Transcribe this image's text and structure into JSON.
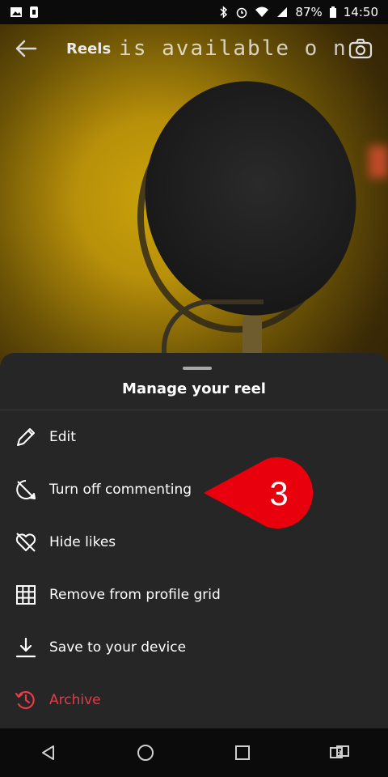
{
  "status_bar": {
    "battery_percent": "87%",
    "time": "14:50",
    "icons": [
      "gallery-icon",
      "sim-icon",
      "bluetooth-icon",
      "alarm-icon",
      "wifi-icon",
      "signal-icon",
      "battery-icon"
    ]
  },
  "video": {
    "title": "Reels",
    "overlay_text": "is available  o n",
    "icons": [
      "back-arrow-icon",
      "camera-icon"
    ]
  },
  "sheet": {
    "title": "Manage your reel",
    "items": [
      {
        "label": "Edit",
        "icon": "pencil-icon"
      },
      {
        "label": "Turn off commenting",
        "icon": "comment-off-icon"
      },
      {
        "label": "Hide likes",
        "icon": "heart-off-icon"
      },
      {
        "label": "Remove from profile grid",
        "icon": "grid-icon"
      },
      {
        "label": "Save to your device",
        "icon": "download-icon"
      },
      {
        "label": "Archive",
        "icon": "archive-icon",
        "color": "#e83a48"
      }
    ]
  },
  "callout": {
    "number": "3",
    "color": "#e8000c"
  },
  "navbar": {
    "icons": [
      "back-triangle-icon",
      "home-circle-icon",
      "recents-square-icon",
      "switch-apps-icon"
    ]
  }
}
